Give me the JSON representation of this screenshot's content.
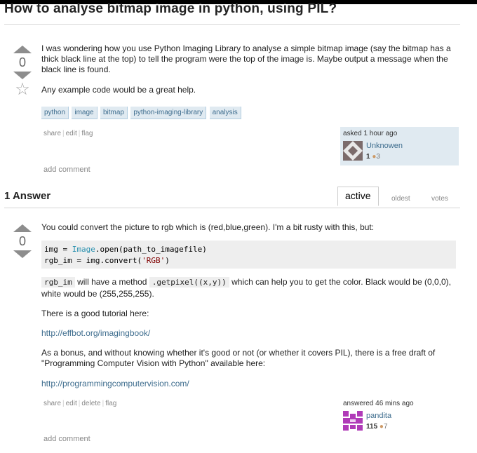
{
  "question": {
    "title": "How to analyse bitmap image in python, using PIL?",
    "vote_count": "0",
    "body": [
      "I was wondering how you use Python Imaging Library to analyse a simple bitmap image (say the bitmap has a thick black line at the top) to tell the program were the top of the image is. Maybe output a message when the black line is found.",
      "Any example code would be a great help."
    ],
    "tags": [
      "python",
      "image",
      "bitmap",
      "python-imaging-library",
      "analysis"
    ],
    "menu": [
      "share",
      "edit",
      "flag"
    ],
    "owner": {
      "action": "asked 1 hour ago",
      "name": "Unknowen",
      "reputation": "1",
      "badge_bronze": "3"
    },
    "add_comment": "add comment"
  },
  "answers_header": {
    "count_label": "1 Answer",
    "tabs": [
      "active",
      "oldest",
      "votes"
    ],
    "active_tab": "active"
  },
  "answer": {
    "vote_count": "0",
    "intro": "You could convert the picture to rgb which is (red,blue,green). I'm a bit rusty with this, but:",
    "code_lines": [
      [
        "img = ",
        "Image",
        ".open(path_to_imagefile)"
      ],
      [
        "rgb_im = img.convert(",
        "'RGB'",
        ")"
      ]
    ],
    "p2_code1": "rgb_im",
    "p2_text1": " will have a method ",
    "p2_code2": ".getpixel((x,y))",
    "p2_text2": " which can help you to get the color. Black would be (0,0,0), white would be (255,255,255).",
    "p3": "There is a good tutorial here:",
    "link1": "http://effbot.org/imagingbook/",
    "p4": "As a bonus, and without knowing whether it's good or not (or whether it covers PIL), there is a free draft of \"Programming Computer Vision with Python\" available here:",
    "link2": "http://programmingcomputervision.com/",
    "menu": [
      "share",
      "edit",
      "delete",
      "flag"
    ],
    "owner": {
      "action": "answered 46 mins ago",
      "name": "pandita",
      "reputation": "115",
      "badge_bronze": "7"
    },
    "add_comment": "add comment"
  },
  "colors": {
    "tag_bg": "#e0eaf1",
    "tag_text": "#3e6d8e",
    "link": "#3e6d8e",
    "bronze": "#cc9966",
    "code_bg": "#eeeeee"
  },
  "icons": {
    "upvote": "triangle-up-icon",
    "downvote": "triangle-down-icon",
    "favorite": "star-icon"
  }
}
